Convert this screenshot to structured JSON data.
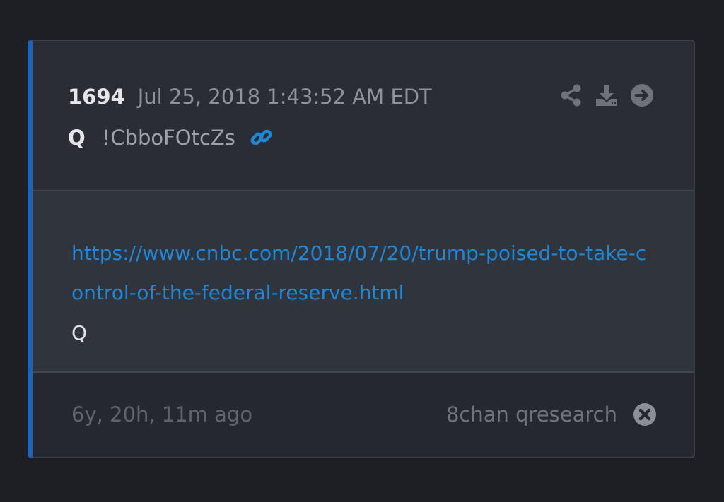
{
  "post": {
    "number": "1694",
    "date": "Jul 25, 2018 1:43:52 AM EDT",
    "author": "Q",
    "tripcode": "!CbboFOtcZs",
    "link_text": "https://www.cnbc.com/2018/07/20/trump-poised-to-take-control-of-the-federal-reserve.html",
    "signature": "Q"
  },
  "footer": {
    "time_ago": "6y, 20h, 11m ago",
    "source": "8chan qresearch"
  },
  "icons": {
    "link": "link-icon",
    "share": "share-icon",
    "download": "download-icon",
    "next": "arrow-right-circle-icon",
    "close": "close-circle-icon"
  },
  "colors": {
    "accent_bar": "#1f63b8",
    "link": "#1f87d6",
    "background": "#1d1f25",
    "card": "#2a2d35",
    "body": "#30343d",
    "footer": "#25282f"
  }
}
